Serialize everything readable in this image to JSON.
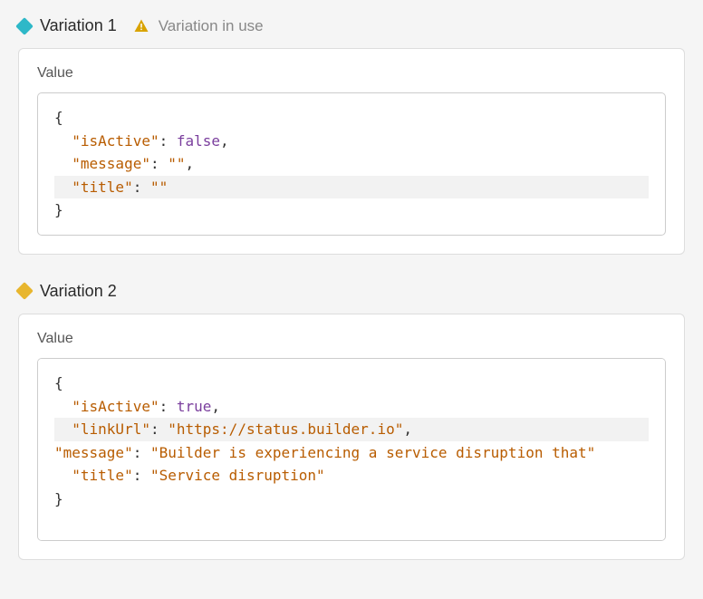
{
  "variations": [
    {
      "id": 1,
      "title": "Variation 1",
      "diamond_color": "teal",
      "in_use": true,
      "in_use_label": "Variation in use",
      "value_label": "Value",
      "code": {
        "lines": [
          {
            "type": "brace-open"
          },
          {
            "type": "prop",
            "key": "isActive",
            "value_type": "bool",
            "value": "false",
            "trailing_comma": true,
            "highlight": false
          },
          {
            "type": "prop",
            "key": "message",
            "value_type": "string",
            "value": "",
            "trailing_comma": true,
            "highlight": false
          },
          {
            "type": "prop",
            "key": "title",
            "value_type": "string",
            "value": "",
            "trailing_comma": false,
            "highlight": true
          },
          {
            "type": "brace-close"
          }
        ]
      },
      "scrollable": false
    },
    {
      "id": 2,
      "title": "Variation 2",
      "diamond_color": "yellow",
      "in_use": false,
      "in_use_label": "",
      "value_label": "Value",
      "code": {
        "lines": [
          {
            "type": "brace-open"
          },
          {
            "type": "prop",
            "key": "isActive",
            "value_type": "bool",
            "value": "true",
            "trailing_comma": true,
            "highlight": false
          },
          {
            "type": "prop",
            "key": "linkUrl",
            "value_type": "string",
            "value": "https://status.builder.io",
            "trailing_comma": true,
            "highlight": true
          },
          {
            "type": "prop",
            "key": "message",
            "value_type": "string",
            "value": "Builder is experiencing a service disruption that",
            "trailing_comma": false,
            "highlight": false,
            "overflow": true
          },
          {
            "type": "prop",
            "key": "title",
            "value_type": "string",
            "value": "Service disruption",
            "trailing_comma": false,
            "highlight": false
          },
          {
            "type": "brace-close"
          }
        ]
      },
      "scrollable": true
    }
  ]
}
